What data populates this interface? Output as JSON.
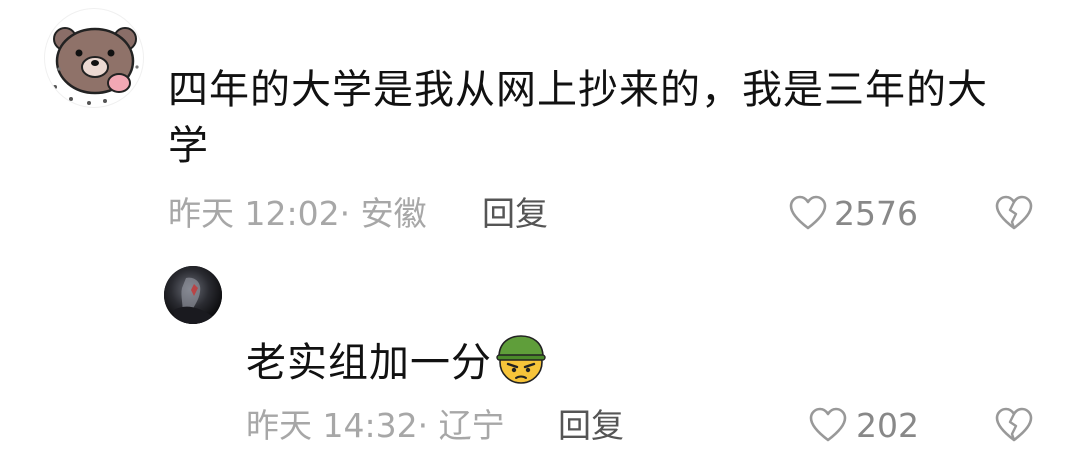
{
  "comment": {
    "text": "四年的大学是我从网上抄来的，我是三年的大学",
    "time": "昨天 12:02·",
    "location": "安徽",
    "reply_label": "回复",
    "likes": "2576"
  },
  "reply": {
    "text": "老实组加一分",
    "emoji": "military-helmet-face",
    "time": "昨天 14:32·",
    "location": "辽宁",
    "reply_label": "回复",
    "likes": "202"
  },
  "icons": {
    "like": "heart-outline-icon",
    "dislike": "broken-heart-icon"
  },
  "colors": {
    "text": "#111111",
    "meta": "#a7a7a7",
    "icon": "#999999"
  }
}
